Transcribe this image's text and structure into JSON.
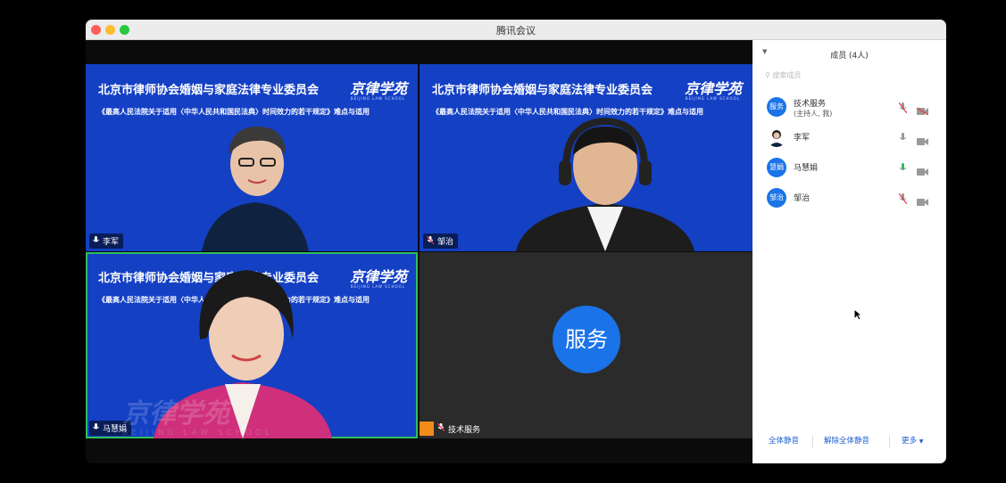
{
  "window": {
    "title": "腾讯会议"
  },
  "slide": {
    "heading": "北京市律师协会婚姻与家庭法律专业委员会",
    "subheading": "《最高人民法院关于适用〈中华人民共和国民法典〉时间效力的若干规定》难点与适用",
    "logo": "京律学苑",
    "logo_sub": "BEIJING LAW SCHOOL"
  },
  "tiles": [
    {
      "name": "李军"
    },
    {
      "name": "邹治"
    },
    {
      "name": "马慧娟"
    },
    {
      "name": "技术服务",
      "avatar": "服务"
    }
  ],
  "watermark": {
    "text": "京律学苑",
    "sub": "BEIJING LAW SCHOOL"
  },
  "panel": {
    "title": "成员 (4人)",
    "search_placeholder": "搜索成员",
    "members": [
      {
        "avatar": "服务",
        "name": "技术服务",
        "role": "(主持人, 我)"
      },
      {
        "avatar": "",
        "name": "李军",
        "role": ""
      },
      {
        "avatar": "慧娟",
        "name": "马慧娟",
        "role": ""
      },
      {
        "avatar": "邹治",
        "name": "邹治",
        "role": ""
      }
    ],
    "footer": {
      "mute_all": "全体静音",
      "unmute_all": "解除全体静音",
      "more": "更多"
    }
  },
  "colors": {
    "accent": "#1a73e8",
    "slide_bg": "#1440c4",
    "active_speaker": "#2fbf5d"
  }
}
